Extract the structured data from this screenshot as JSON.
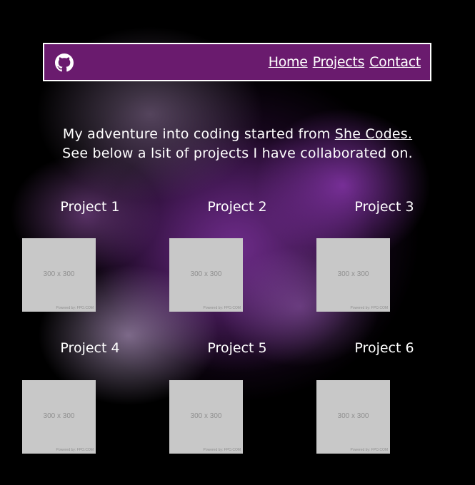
{
  "nav": {
    "github_icon": "github-icon",
    "links": [
      "Home",
      "Projects",
      "Contact"
    ]
  },
  "intro": {
    "line1_text": "My adventure into coding started from ",
    "line1_link": "She Codes.",
    "line2_text": "See below a lsit of projects I have collaborated on."
  },
  "projects": [
    {
      "title": "Project 1",
      "placeholder": "300 x 300",
      "powered": "Powered by: FPO.COM"
    },
    {
      "title": "Project 2",
      "placeholder": "300 x 300",
      "powered": "Powered by: FPO.COM"
    },
    {
      "title": "Project 3",
      "placeholder": "300 x 300",
      "powered": "Powered by: FPO.COM"
    },
    {
      "title": "Project 4",
      "placeholder": "300 x 300",
      "powered": "Powered by: FPO.COM"
    },
    {
      "title": "Project 5",
      "placeholder": "300 x 300",
      "powered": "Powered by: FPO.COM"
    },
    {
      "title": "Project 6",
      "placeholder": "300 x 300",
      "powered": "Powered by: FPO.COM"
    }
  ],
  "colors": {
    "navbar_bg": "#6a1b6e",
    "page_bg": "#000000",
    "thumb_bg": "#c8c8c8"
  }
}
